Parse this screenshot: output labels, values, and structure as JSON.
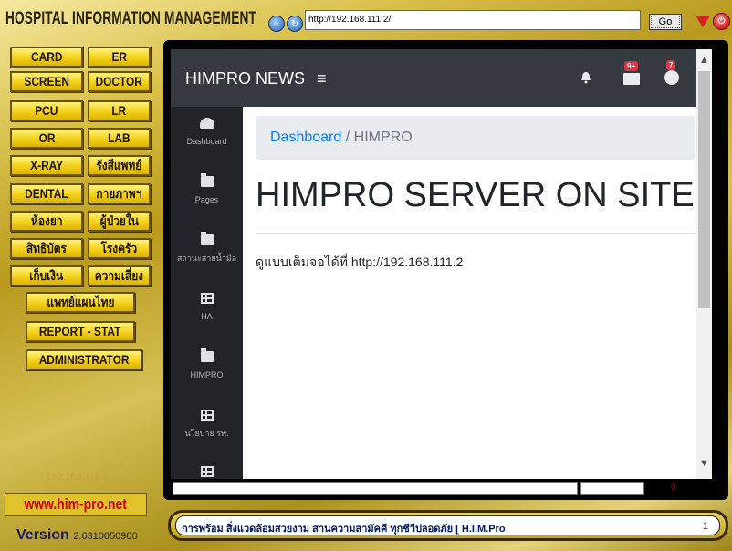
{
  "window": {
    "title": "HOSPITAL INFORMATION MANAGEMENT",
    "url": "http://192.168.111.2/",
    "go_label": "Go"
  },
  "menu": [
    {
      "key": "card",
      "label": "CARD"
    },
    {
      "key": "er",
      "label": "ER"
    },
    {
      "key": "screen",
      "label": "SCREEN"
    },
    {
      "key": "doctor",
      "label": "DOCTOR"
    },
    {
      "key": "pcu",
      "label": "PCU"
    },
    {
      "key": "lr",
      "label": "LR"
    },
    {
      "key": "or",
      "label": "OR"
    },
    {
      "key": "lab",
      "label": "LAB"
    },
    {
      "key": "xray",
      "label": "X-RAY"
    },
    {
      "key": "radiology",
      "label": "รังสีแพทย์"
    },
    {
      "key": "dental",
      "label": "DENTAL"
    },
    {
      "key": "physio",
      "label": "กายภาพฯ"
    },
    {
      "key": "pharmacy",
      "label": "ห้องยา"
    },
    {
      "key": "inpatient",
      "label": "ผู้ป่วยใน"
    },
    {
      "key": "rights",
      "label": "สิทธิบัตร"
    },
    {
      "key": "kitchen",
      "label": "โรงครัว"
    },
    {
      "key": "finance",
      "label": "เก็บเงิน"
    },
    {
      "key": "risk",
      "label": "ความเสี่ยง"
    },
    {
      "key": "thaimed",
      "label": "แพทย์แผนไทย"
    },
    {
      "key": "report",
      "label": "REPORT - STAT"
    },
    {
      "key": "admin",
      "label": "ADMINISTRATOR"
    }
  ],
  "footer_left": {
    "ip": "192.168.111.2",
    "site": "www.him-pro.net",
    "version_label": "Version",
    "version_number": "2.6310050900"
  },
  "web": {
    "brand": "HIMPRO NEWS",
    "menu_glyph": "≡",
    "badge_messages": "9+",
    "badge_user": "7",
    "sidebar": [
      {
        "label": "Dashboard",
        "icon": "tachometer-icon"
      },
      {
        "label": "Pages",
        "icon": "folder-icon"
      },
      {
        "label": "สถานะสายน้ำมือ",
        "icon": "folder-icon"
      },
      {
        "label": "HA",
        "icon": "table-icon"
      },
      {
        "label": "HIMPRO",
        "icon": "folder-icon"
      },
      {
        "label": "นโยบาย รพ.",
        "icon": "table-icon"
      },
      {
        "label": "",
        "icon": "table-icon"
      }
    ],
    "breadcrumb_link": "Dashboard",
    "breadcrumb_sep": "/",
    "breadcrumb_current": "HIMPRO",
    "page_title": "HIMPRO SERVER ON SITE",
    "body_text": "ดูแบบเต็มจอได้ที่ http://192.168.111.2"
  },
  "status": {
    "value": "0"
  },
  "ticker": {
    "text": "การพร้อม สิ่งแวดล้อมสวยงาม สานความสามัคคี ทุกชีวีปลอดภัย   [ H.I.M.Pro",
    "count": "1"
  },
  "colors": {
    "gold": "#d9b400",
    "navbar": "#343a40",
    "sidebar": "#212529",
    "link": "#007bff",
    "badge": "#dc3545"
  }
}
